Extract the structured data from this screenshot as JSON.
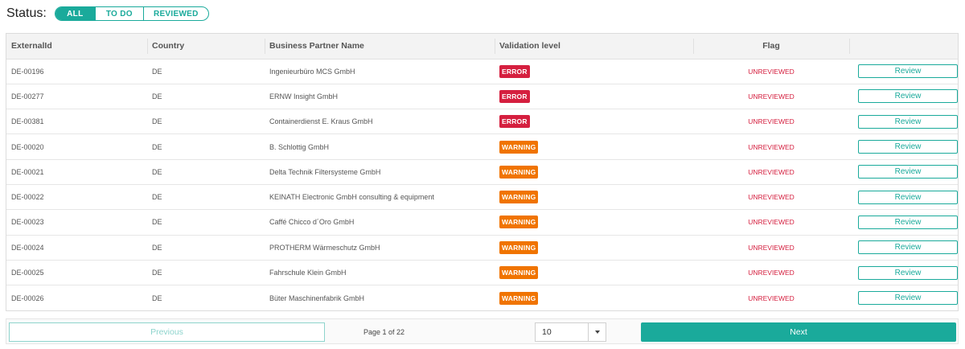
{
  "status": {
    "label": "Status:",
    "filters": [
      {
        "label": "ALL",
        "active": true
      },
      {
        "label": "TO DO",
        "active": false
      },
      {
        "label": "REVIEWED",
        "active": false
      }
    ]
  },
  "table": {
    "headers": [
      "ExternalId",
      "Country",
      "Business Partner Name",
      "Validation level",
      "Flag",
      ""
    ],
    "rows": [
      {
        "externalId": "DE-00196",
        "country": "DE",
        "name": "Ingenieurbüro MCS GmbH",
        "level": "ERROR",
        "flag": "UNREVIEWED",
        "action": "Review"
      },
      {
        "externalId": "DE-00277",
        "country": "DE",
        "name": "ERNW Insight GmbH",
        "level": "ERROR",
        "flag": "UNREVIEWED",
        "action": "Review"
      },
      {
        "externalId": "DE-00381",
        "country": "DE",
        "name": "Containerdienst E. Kraus GmbH",
        "level": "ERROR",
        "flag": "UNREVIEWED",
        "action": "Review"
      },
      {
        "externalId": "DE-00020",
        "country": "DE",
        "name": "B. Schlottig GmbH",
        "level": "WARNING",
        "flag": "UNREVIEWED",
        "action": "Review"
      },
      {
        "externalId": "DE-00021",
        "country": "DE",
        "name": "Delta Technik Filtersysteme GmbH",
        "level": "WARNING",
        "flag": "UNREVIEWED",
        "action": "Review"
      },
      {
        "externalId": "DE-00022",
        "country": "DE",
        "name": "KEINATH Electronic GmbH consulting & equipment",
        "level": "WARNING",
        "flag": "UNREVIEWED",
        "action": "Review"
      },
      {
        "externalId": "DE-00023",
        "country": "DE",
        "name": "Caffé Chicco d´Oro GmbH",
        "level": "WARNING",
        "flag": "UNREVIEWED",
        "action": "Review"
      },
      {
        "externalId": "DE-00024",
        "country": "DE",
        "name": "PROTHERM Wärmeschutz GmbH",
        "level": "WARNING",
        "flag": "UNREVIEWED",
        "action": "Review"
      },
      {
        "externalId": "DE-00025",
        "country": "DE",
        "name": "Fahrschule Klein GmbH",
        "level": "WARNING",
        "flag": "UNREVIEWED",
        "action": "Review"
      },
      {
        "externalId": "DE-00026",
        "country": "DE",
        "name": "Büter Maschinenfabrik GmbH",
        "level": "WARNING",
        "flag": "UNREVIEWED",
        "action": "Review"
      }
    ]
  },
  "pagination": {
    "previous": "Previous",
    "pageInfo": "Page 1 of 22",
    "pageSize": "10",
    "next": "Next"
  },
  "colors": {
    "accent": "#1aaa9b",
    "error": "#d51f3f",
    "warning": "#f07400"
  }
}
